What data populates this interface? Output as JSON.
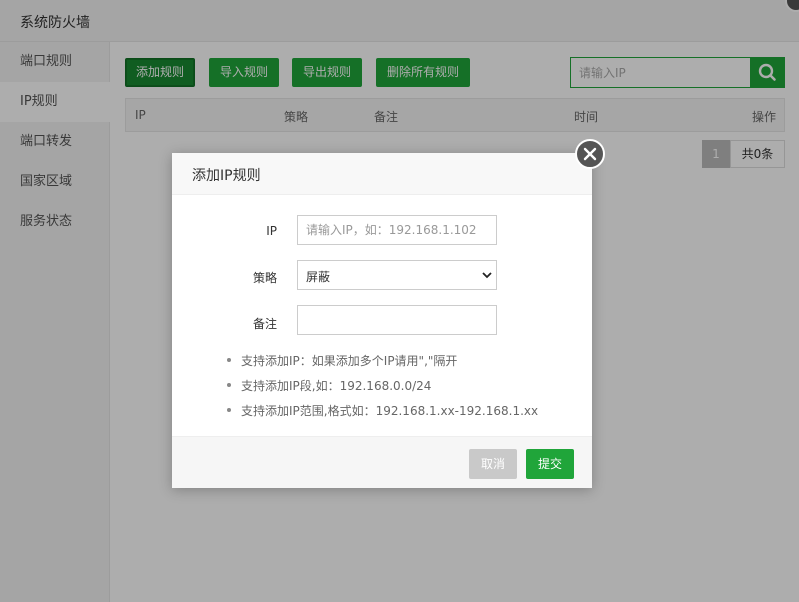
{
  "window": {
    "title": "系统防火墙"
  },
  "sidebar": {
    "items": [
      {
        "label": "端口规则"
      },
      {
        "label": "IP规则"
      },
      {
        "label": "端口转发"
      },
      {
        "label": "国家区域"
      },
      {
        "label": "服务状态"
      }
    ]
  },
  "toolbar": {
    "add_rule": "添加规则",
    "import_rules": "导入规则",
    "export_rules": "导出规则",
    "delete_all": "删除所有规则"
  },
  "search": {
    "placeholder": "请输入IP"
  },
  "table": {
    "columns": [
      "IP",
      "策略",
      "备注",
      "时间",
      "操作"
    ]
  },
  "pager": {
    "current_page": "1",
    "total": "共0条"
  },
  "modal": {
    "title": "添加IP规则",
    "ip_label": "IP",
    "ip_placeholder": "请输入IP，如：192.168.1.102",
    "policy_label": "策略",
    "policy_value": "屏蔽",
    "remark_label": "备注",
    "remark_value": "",
    "tips": [
      "支持添加IP：如果添加多个IP请用\",\"隔开",
      "支持添加IP段,如：192.168.0.0/24",
      "支持添加IP范围,格式如：192.168.1.xx-192.168.1.xx"
    ],
    "cancel_label": "取消",
    "submit_label": "提交"
  },
  "colors": {
    "accent": "#20a53a",
    "overlay": "rgba(0,0,0,0.32)",
    "cancel": "#c9c9c9"
  }
}
